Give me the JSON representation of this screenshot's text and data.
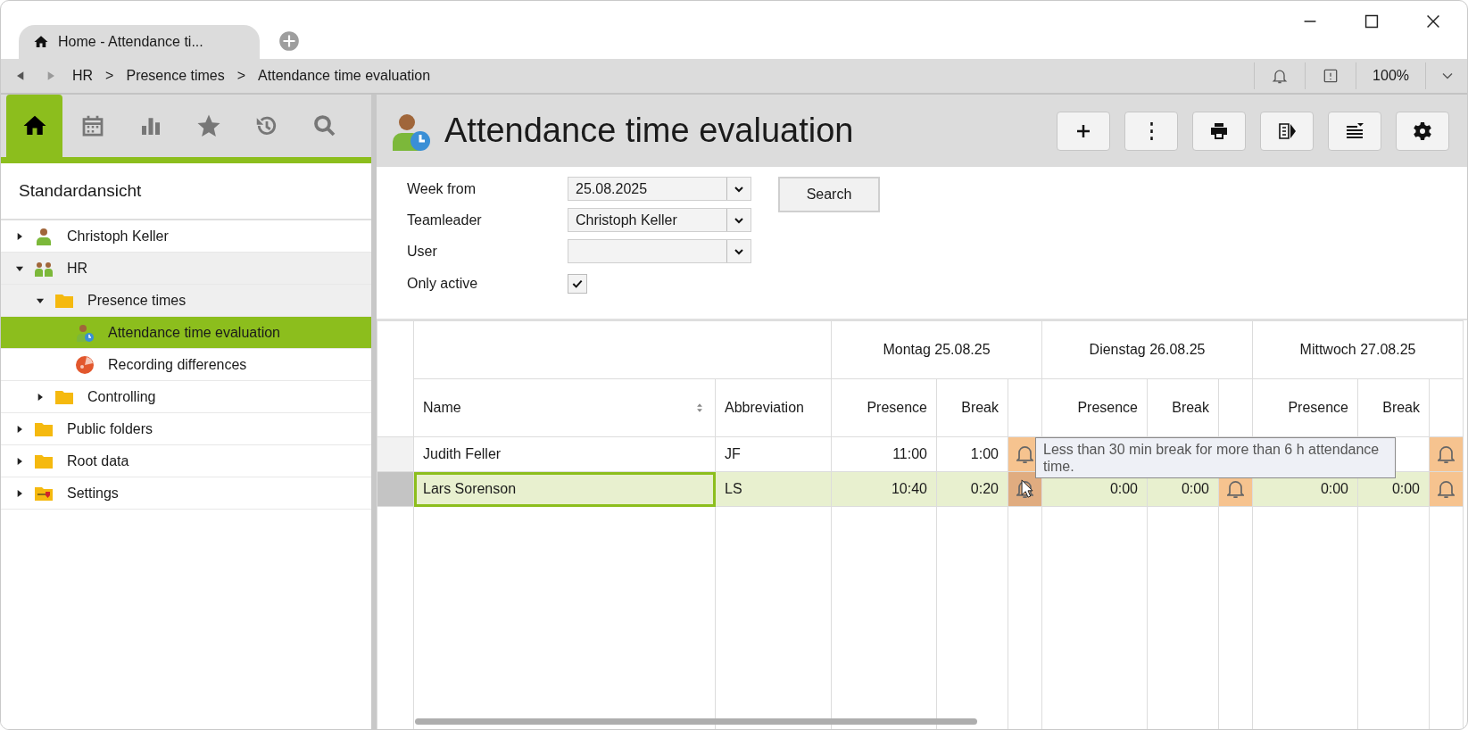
{
  "window": {
    "tab_title": "Home - Attendance ti..."
  },
  "nav": {
    "breadcrumb": [
      {
        "label": "HR"
      },
      {
        "separator": ">",
        "label": "Presence times"
      },
      {
        "separator": ">",
        "label": "Attendance time evaluation"
      }
    ],
    "zoom": "100%"
  },
  "sidebar": {
    "tabs": [
      {
        "kind": "home",
        "selected": true
      },
      {
        "kind": "calendar",
        "selected": false
      },
      {
        "kind": "barchart",
        "selected": false
      },
      {
        "kind": "star",
        "selected": false
      },
      {
        "kind": "history",
        "selected": false
      },
      {
        "kind": "search",
        "selected": false
      }
    ],
    "view_title": "Standardansicht",
    "tree": [
      {
        "label": "Christoph Keller",
        "kind": "person",
        "expanded": false,
        "selected": false,
        "highlighted": false
      },
      {
        "label": "HR",
        "kind": "group",
        "expanded": true,
        "selected": false,
        "highlighted": true,
        "children": [
          {
            "label": "Presence times",
            "kind": "folder",
            "expanded": true,
            "selected": false,
            "highlighted": true,
            "children": [
              {
                "label": "Attendance time evaluation",
                "kind": "evaluation",
                "selected": true,
                "highlighted": false
              },
              {
                "label": "Recording differences",
                "kind": "pie",
                "selected": false,
                "highlighted": false
              }
            ]
          },
          {
            "label": "Controlling",
            "kind": "folder",
            "expanded": false,
            "selected": false,
            "highlighted": false
          }
        ]
      },
      {
        "label": "Public folders",
        "kind": "folder",
        "expanded": false,
        "selected": false,
        "highlighted": false
      },
      {
        "label": "Root data",
        "kind": "folder",
        "expanded": false,
        "selected": false,
        "highlighted": false
      },
      {
        "label": "Settings",
        "kind": "settings",
        "expanded": false,
        "selected": false,
        "highlighted": false
      }
    ]
  },
  "page": {
    "title": "Attendance time evaluation",
    "toolbar": [
      {
        "kind": "plus"
      },
      {
        "kind": "more"
      },
      {
        "kind": "print"
      },
      {
        "kind": "export"
      },
      {
        "kind": "list"
      },
      {
        "kind": "gear"
      }
    ]
  },
  "filters": [
    {
      "kind": "dropdown",
      "label": "Week from",
      "value": "25.08.2025"
    },
    {
      "kind": "dropdown",
      "label": "Teamleader",
      "value": "Christoph Keller"
    },
    {
      "kind": "dropdown",
      "label": "User"
    },
    {
      "kind": "checkbox",
      "label": "Only active",
      "checked": true
    }
  ],
  "search_button": "Search",
  "grid": {
    "days": [
      {
        "label": "Montag 25.08.25",
        "columns": [
          "Presence",
          "Break"
        ]
      },
      {
        "label": "Dienstag 26.08.25",
        "columns": [
          "Presence",
          "Break"
        ]
      },
      {
        "label": "Mittwoch 27.08.25",
        "columns": [
          "Presence",
          "Break"
        ]
      }
    ],
    "columns": [
      "Name",
      "Abbreviation"
    ],
    "rows": [
      {
        "name": "Judith Feller",
        "abbreviation": "JF",
        "selected": false,
        "monday": {
          "presence": "11:00",
          "break": "1:00",
          "alert": true,
          "hovered": false
        },
        "wednesday": {
          "alert": true,
          "hovered": false
        }
      },
      {
        "name": "Lars Sorenson",
        "abbreviation": "LS",
        "selected": true,
        "monday": {
          "presence": "10:40",
          "break": "0:20",
          "alert": true,
          "hovered": true
        },
        "tuesday": {
          "presence": "0:00",
          "break": "0:00",
          "alert": true,
          "hovered": false
        },
        "wednesday": {
          "presence": "0:00",
          "break": "0:00",
          "alert": true,
          "hovered": false
        }
      }
    ],
    "tooltip": "Less than 30 min break for more than 6 h attendance time."
  }
}
